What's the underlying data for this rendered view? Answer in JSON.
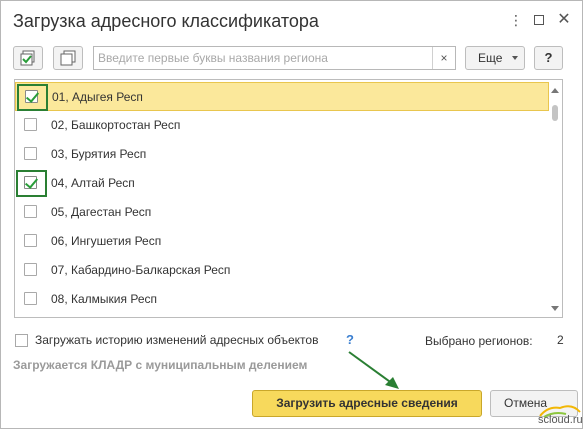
{
  "window": {
    "title": "Загрузка адресного классификатора",
    "menu_icon": "more-vertical-icon",
    "maximize_icon": "maximize-icon",
    "close_icon": "close-icon"
  },
  "toolbar": {
    "check_all_icon": "check-all-icon",
    "uncheck_all_icon": "uncheck-all-icon",
    "search_placeholder": "Введите первые буквы названия региона",
    "search_value": "",
    "clear_label": "×",
    "more_label": "Еще",
    "help_label": "?"
  },
  "regions": [
    {
      "label": "01, Адыгея Респ",
      "checked": true,
      "selected": true,
      "highlighted": true
    },
    {
      "label": "02, Башкортостан Респ",
      "checked": false,
      "selected": false,
      "highlighted": false
    },
    {
      "label": "03, Бурятия Респ",
      "checked": false,
      "selected": false,
      "highlighted": false
    },
    {
      "label": "04, Алтай Респ",
      "checked": true,
      "selected": false,
      "highlighted": true
    },
    {
      "label": "05, Дагестан Респ",
      "checked": false,
      "selected": false,
      "highlighted": false
    },
    {
      "label": "06, Ингушетия Респ",
      "checked": false,
      "selected": false,
      "highlighted": false
    },
    {
      "label": "07, Кабардино-Балкарская Респ",
      "checked": false,
      "selected": false,
      "highlighted": false
    },
    {
      "label": "08, Калмыкия Респ",
      "checked": false,
      "selected": false,
      "highlighted": false
    }
  ],
  "footer": {
    "history_label": "Загружать историю изменений адресных объектов",
    "history_help": "?",
    "history_checked": false,
    "selected_label": "Выбрано регионов:",
    "selected_count": "2",
    "status_text": "Загружается КЛАДР с муниципальным делением",
    "load_button": "Загрузить адресные сведения",
    "cancel_button": "Отмена"
  },
  "watermark": {
    "text": "scloud.ru"
  },
  "colors": {
    "accent_yellow": "#f7d95c",
    "selected_row": "#fbe89b",
    "checkmark_green": "#2a9d3a",
    "annotation_green": "#2a7f33"
  }
}
